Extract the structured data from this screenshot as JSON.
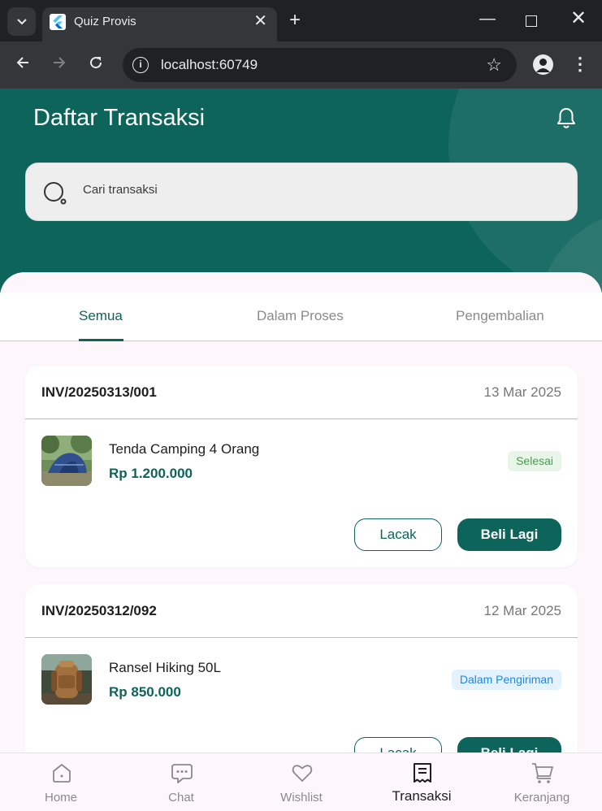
{
  "browser": {
    "tab_title": "Quiz Provis",
    "url": "localhost:60749",
    "close_glyph": "✕",
    "new_tab_glyph": "+",
    "minimize_glyph": "—",
    "window_close_glyph": "✕"
  },
  "header": {
    "title": "Daftar Transaksi",
    "search_placeholder": "Cari transaksi"
  },
  "tabs": [
    {
      "label": "Semua",
      "active": true
    },
    {
      "label": "Dalam Proses",
      "active": false
    },
    {
      "label": "Pengembalian",
      "active": false
    }
  ],
  "transactions": [
    {
      "invoice": "INV/20250313/001",
      "date": "13 Mar 2025",
      "product": "Tenda Camping 4 Orang",
      "price": "Rp 1.200.000",
      "status": "Selesai",
      "track_label": "Lacak",
      "buy_again_label": "Beli Lagi"
    },
    {
      "invoice": "INV/20250312/092",
      "date": "12 Mar 2025",
      "product": "Ransel Hiking 50L",
      "price": "Rp 850.000",
      "status": "Dalam Pengiriman",
      "track_label": "Lacak",
      "buy_again_label": "Beli Lagi"
    }
  ],
  "bottom_nav": [
    {
      "label": "Home",
      "icon": "home-icon",
      "active": false
    },
    {
      "label": "Chat",
      "icon": "chat-icon",
      "active": false
    },
    {
      "label": "Wishlist",
      "icon": "heart-icon",
      "active": false
    },
    {
      "label": "Transaksi",
      "icon": "receipt-icon",
      "active": true
    },
    {
      "label": "Keranjang",
      "icon": "cart-icon",
      "active": false
    }
  ],
  "colors": {
    "primary": "#0c645b",
    "status_done": "#43a047",
    "status_shipping": "#1e88e5"
  }
}
